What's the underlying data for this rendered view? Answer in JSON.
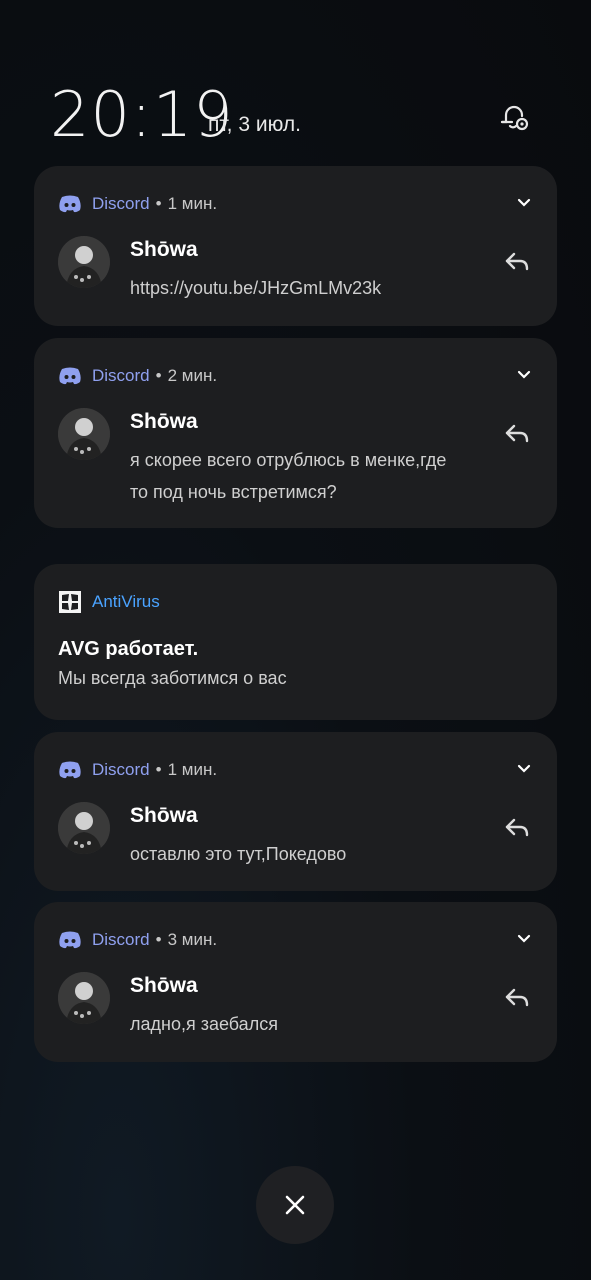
{
  "status": {
    "time": "20:19",
    "date": "пт, 3 июл."
  },
  "notifications": [
    {
      "app": "Discord",
      "time": "1 мин.",
      "sender": "Shōwa",
      "message": "https://youtu.be/JHzGmLMv23k"
    },
    {
      "app": "Discord",
      "time": "2 мин.",
      "sender": "Shōwa",
      "message": "я скорее всего отрублюсь в менке,где то под ночь встретимся?"
    },
    {
      "app": "AntiVirus",
      "title": "AVG работает.",
      "message": "Мы всегда заботимся о вас"
    },
    {
      "app": "Discord",
      "time": "1 мин.",
      "sender": "Shōwa",
      "message": "оставлю это тут,Покедово"
    },
    {
      "app": "Discord",
      "time": "3 мин.",
      "sender": "Shōwa",
      "message": "ладно,я заебался"
    }
  ],
  "colors": {
    "discord_accent": "#8fa0ef",
    "antivirus_accent": "#4aa3ff",
    "card_bg": "#1d1e20"
  },
  "icons": {
    "discord": "discord-icon",
    "antivirus": "antivirus-icon",
    "reply": "reply-icon",
    "expand": "chevron-down-icon",
    "close": "close-icon",
    "settings": "notification-settings-icon"
  }
}
